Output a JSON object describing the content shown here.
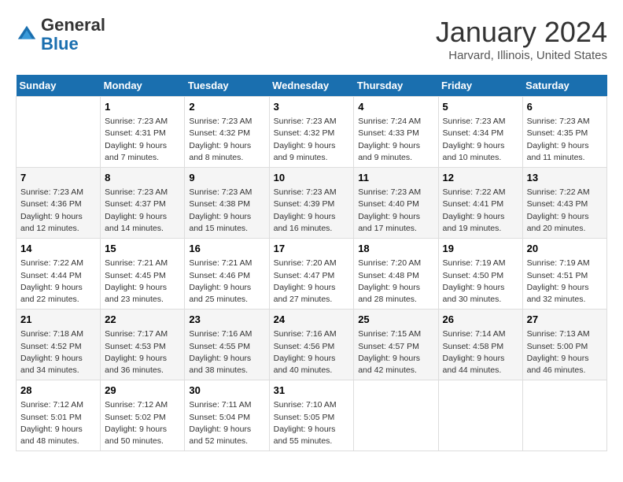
{
  "header": {
    "logo_general": "General",
    "logo_blue": "Blue",
    "month_title": "January 2024",
    "location": "Harvard, Illinois, United States"
  },
  "days_of_week": [
    "Sunday",
    "Monday",
    "Tuesday",
    "Wednesday",
    "Thursday",
    "Friday",
    "Saturday"
  ],
  "weeks": [
    [
      {
        "day": "",
        "info": ""
      },
      {
        "day": "1",
        "info": "Sunrise: 7:23 AM\nSunset: 4:31 PM\nDaylight: 9 hours\nand 7 minutes."
      },
      {
        "day": "2",
        "info": "Sunrise: 7:23 AM\nSunset: 4:32 PM\nDaylight: 9 hours\nand 8 minutes."
      },
      {
        "day": "3",
        "info": "Sunrise: 7:23 AM\nSunset: 4:32 PM\nDaylight: 9 hours\nand 9 minutes."
      },
      {
        "day": "4",
        "info": "Sunrise: 7:24 AM\nSunset: 4:33 PM\nDaylight: 9 hours\nand 9 minutes."
      },
      {
        "day": "5",
        "info": "Sunrise: 7:23 AM\nSunset: 4:34 PM\nDaylight: 9 hours\nand 10 minutes."
      },
      {
        "day": "6",
        "info": "Sunrise: 7:23 AM\nSunset: 4:35 PM\nDaylight: 9 hours\nand 11 minutes."
      }
    ],
    [
      {
        "day": "7",
        "info": "Sunrise: 7:23 AM\nSunset: 4:36 PM\nDaylight: 9 hours\nand 12 minutes."
      },
      {
        "day": "8",
        "info": "Sunrise: 7:23 AM\nSunset: 4:37 PM\nDaylight: 9 hours\nand 14 minutes."
      },
      {
        "day": "9",
        "info": "Sunrise: 7:23 AM\nSunset: 4:38 PM\nDaylight: 9 hours\nand 15 minutes."
      },
      {
        "day": "10",
        "info": "Sunrise: 7:23 AM\nSunset: 4:39 PM\nDaylight: 9 hours\nand 16 minutes."
      },
      {
        "day": "11",
        "info": "Sunrise: 7:23 AM\nSunset: 4:40 PM\nDaylight: 9 hours\nand 17 minutes."
      },
      {
        "day": "12",
        "info": "Sunrise: 7:22 AM\nSunset: 4:41 PM\nDaylight: 9 hours\nand 19 minutes."
      },
      {
        "day": "13",
        "info": "Sunrise: 7:22 AM\nSunset: 4:43 PM\nDaylight: 9 hours\nand 20 minutes."
      }
    ],
    [
      {
        "day": "14",
        "info": "Sunrise: 7:22 AM\nSunset: 4:44 PM\nDaylight: 9 hours\nand 22 minutes."
      },
      {
        "day": "15",
        "info": "Sunrise: 7:21 AM\nSunset: 4:45 PM\nDaylight: 9 hours\nand 23 minutes."
      },
      {
        "day": "16",
        "info": "Sunrise: 7:21 AM\nSunset: 4:46 PM\nDaylight: 9 hours\nand 25 minutes."
      },
      {
        "day": "17",
        "info": "Sunrise: 7:20 AM\nSunset: 4:47 PM\nDaylight: 9 hours\nand 27 minutes."
      },
      {
        "day": "18",
        "info": "Sunrise: 7:20 AM\nSunset: 4:48 PM\nDaylight: 9 hours\nand 28 minutes."
      },
      {
        "day": "19",
        "info": "Sunrise: 7:19 AM\nSunset: 4:50 PM\nDaylight: 9 hours\nand 30 minutes."
      },
      {
        "day": "20",
        "info": "Sunrise: 7:19 AM\nSunset: 4:51 PM\nDaylight: 9 hours\nand 32 minutes."
      }
    ],
    [
      {
        "day": "21",
        "info": "Sunrise: 7:18 AM\nSunset: 4:52 PM\nDaylight: 9 hours\nand 34 minutes."
      },
      {
        "day": "22",
        "info": "Sunrise: 7:17 AM\nSunset: 4:53 PM\nDaylight: 9 hours\nand 36 minutes."
      },
      {
        "day": "23",
        "info": "Sunrise: 7:16 AM\nSunset: 4:55 PM\nDaylight: 9 hours\nand 38 minutes."
      },
      {
        "day": "24",
        "info": "Sunrise: 7:16 AM\nSunset: 4:56 PM\nDaylight: 9 hours\nand 40 minutes."
      },
      {
        "day": "25",
        "info": "Sunrise: 7:15 AM\nSunset: 4:57 PM\nDaylight: 9 hours\nand 42 minutes."
      },
      {
        "day": "26",
        "info": "Sunrise: 7:14 AM\nSunset: 4:58 PM\nDaylight: 9 hours\nand 44 minutes."
      },
      {
        "day": "27",
        "info": "Sunrise: 7:13 AM\nSunset: 5:00 PM\nDaylight: 9 hours\nand 46 minutes."
      }
    ],
    [
      {
        "day": "28",
        "info": "Sunrise: 7:12 AM\nSunset: 5:01 PM\nDaylight: 9 hours\nand 48 minutes."
      },
      {
        "day": "29",
        "info": "Sunrise: 7:12 AM\nSunset: 5:02 PM\nDaylight: 9 hours\nand 50 minutes."
      },
      {
        "day": "30",
        "info": "Sunrise: 7:11 AM\nSunset: 5:04 PM\nDaylight: 9 hours\nand 52 minutes."
      },
      {
        "day": "31",
        "info": "Sunrise: 7:10 AM\nSunset: 5:05 PM\nDaylight: 9 hours\nand 55 minutes."
      },
      {
        "day": "",
        "info": ""
      },
      {
        "day": "",
        "info": ""
      },
      {
        "day": "",
        "info": ""
      }
    ]
  ]
}
